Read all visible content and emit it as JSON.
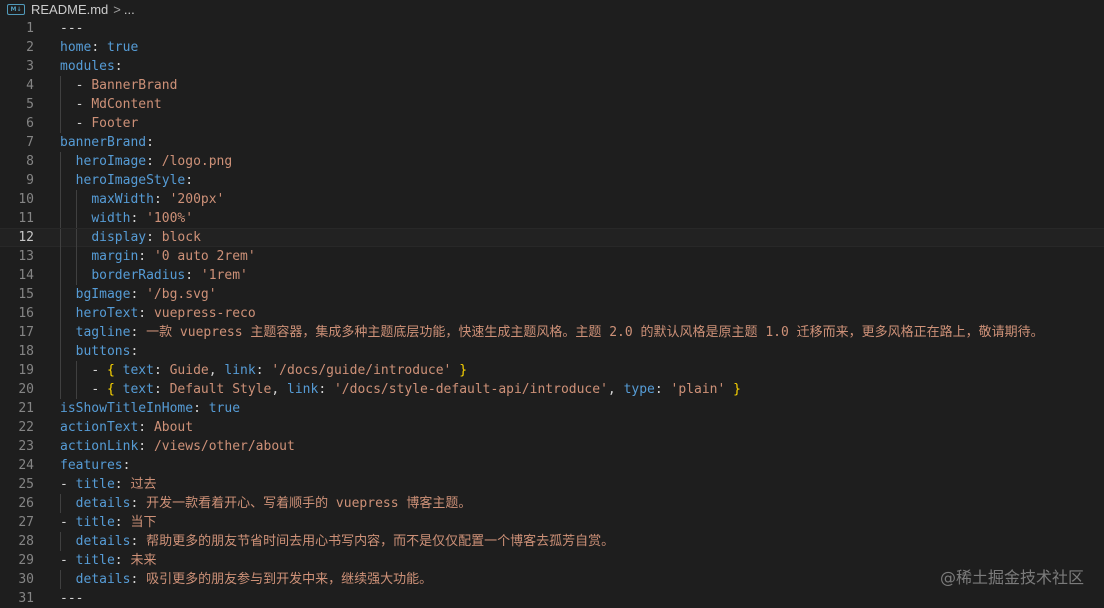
{
  "breadcrumb": {
    "file_icon": "markdown-icon",
    "file": "README.md",
    "separator": ">",
    "ellipsis": "..."
  },
  "watermark": "@稀土掘金技术社区",
  "colors": {
    "key": "#569cd6",
    "string": "#ce9178",
    "bracket": "#ffd700",
    "text": "#d4d4d4",
    "line_number": "#858585"
  },
  "current_line": 12,
  "lines": [
    {
      "n": "1",
      "indent": 0,
      "t": [
        [
          "p",
          "---"
        ]
      ]
    },
    {
      "n": "2",
      "indent": 0,
      "t": [
        [
          "k",
          "home"
        ],
        [
          "p",
          ": "
        ],
        [
          "b",
          "true"
        ]
      ]
    },
    {
      "n": "3",
      "indent": 0,
      "t": [
        [
          "k",
          "modules"
        ],
        [
          "p",
          ":"
        ]
      ]
    },
    {
      "n": "4",
      "indent": 1,
      "t": [
        [
          "p",
          "- "
        ],
        [
          "s",
          "BannerBrand"
        ]
      ]
    },
    {
      "n": "5",
      "indent": 1,
      "t": [
        [
          "p",
          "- "
        ],
        [
          "s",
          "MdContent"
        ]
      ]
    },
    {
      "n": "6",
      "indent": 1,
      "t": [
        [
          "p",
          "- "
        ],
        [
          "s",
          "Footer"
        ]
      ]
    },
    {
      "n": "7",
      "indent": 0,
      "t": [
        [
          "k",
          "bannerBrand"
        ],
        [
          "p",
          ":"
        ]
      ]
    },
    {
      "n": "8",
      "indent": 1,
      "t": [
        [
          "k",
          "heroImage"
        ],
        [
          "p",
          ": "
        ],
        [
          "s",
          "/logo.png"
        ]
      ]
    },
    {
      "n": "9",
      "indent": 1,
      "t": [
        [
          "k",
          "heroImageStyle"
        ],
        [
          "p",
          ":"
        ]
      ]
    },
    {
      "n": "10",
      "indent": 2,
      "t": [
        [
          "k",
          "maxWidth"
        ],
        [
          "p",
          ": "
        ],
        [
          "s",
          "'200px'"
        ]
      ]
    },
    {
      "n": "11",
      "indent": 2,
      "t": [
        [
          "k",
          "width"
        ],
        [
          "p",
          ": "
        ],
        [
          "s",
          "'100%'"
        ]
      ]
    },
    {
      "n": "12",
      "indent": 2,
      "t": [
        [
          "k",
          "display"
        ],
        [
          "p",
          ": "
        ],
        [
          "s",
          "block"
        ]
      ]
    },
    {
      "n": "13",
      "indent": 2,
      "t": [
        [
          "k",
          "margin"
        ],
        [
          "p",
          ": "
        ],
        [
          "s",
          "'0 auto 2rem'"
        ]
      ]
    },
    {
      "n": "14",
      "indent": 2,
      "t": [
        [
          "k",
          "borderRadius"
        ],
        [
          "p",
          ": "
        ],
        [
          "s",
          "'1rem'"
        ]
      ]
    },
    {
      "n": "15",
      "indent": 1,
      "t": [
        [
          "k",
          "bgImage"
        ],
        [
          "p",
          ": "
        ],
        [
          "s",
          "'/bg.svg'"
        ]
      ]
    },
    {
      "n": "16",
      "indent": 1,
      "t": [
        [
          "k",
          "heroText"
        ],
        [
          "p",
          ": "
        ],
        [
          "s",
          "vuepress-reco"
        ]
      ]
    },
    {
      "n": "17",
      "indent": 1,
      "t": [
        [
          "k",
          "tagline"
        ],
        [
          "p",
          ": "
        ],
        [
          "s",
          "一款 vuepress 主题容器，集成多种主题底层功能，快速生成主题风格。主题 2.0 的默认风格是原主题 1.0 迁移而来，更多风格正在路上，敬请期待。"
        ]
      ]
    },
    {
      "n": "18",
      "indent": 1,
      "t": [
        [
          "k",
          "buttons"
        ],
        [
          "p",
          ":"
        ]
      ]
    },
    {
      "n": "19",
      "indent": 2,
      "t": [
        [
          "p",
          "- "
        ],
        [
          "br",
          "{ "
        ],
        [
          "k",
          "text"
        ],
        [
          "p",
          ": "
        ],
        [
          "s",
          "Guide"
        ],
        [
          "p",
          ", "
        ],
        [
          "k",
          "link"
        ],
        [
          "p",
          ": "
        ],
        [
          "s",
          "'/docs/guide/introduce'"
        ],
        [
          "br",
          " }"
        ]
      ]
    },
    {
      "n": "20",
      "indent": 2,
      "t": [
        [
          "p",
          "- "
        ],
        [
          "br",
          "{ "
        ],
        [
          "k",
          "text"
        ],
        [
          "p",
          ": "
        ],
        [
          "s",
          "Default Style"
        ],
        [
          "p",
          ", "
        ],
        [
          "k",
          "link"
        ],
        [
          "p",
          ": "
        ],
        [
          "s",
          "'/docs/style-default-api/introduce'"
        ],
        [
          "p",
          ", "
        ],
        [
          "k",
          "type"
        ],
        [
          "p",
          ": "
        ],
        [
          "s",
          "'plain'"
        ],
        [
          "br",
          " }"
        ]
      ]
    },
    {
      "n": "21",
      "indent": 0,
      "t": [
        [
          "k",
          "isShowTitleInHome"
        ],
        [
          "p",
          ": "
        ],
        [
          "b",
          "true"
        ]
      ]
    },
    {
      "n": "22",
      "indent": 0,
      "t": [
        [
          "k",
          "actionText"
        ],
        [
          "p",
          ": "
        ],
        [
          "s",
          "About"
        ]
      ]
    },
    {
      "n": "23",
      "indent": 0,
      "t": [
        [
          "k",
          "actionLink"
        ],
        [
          "p",
          ": "
        ],
        [
          "s",
          "/views/other/about"
        ]
      ]
    },
    {
      "n": "24",
      "indent": 0,
      "t": [
        [
          "k",
          "features"
        ],
        [
          "p",
          ":"
        ]
      ]
    },
    {
      "n": "25",
      "indent": 0,
      "t": [
        [
          "p",
          "- "
        ],
        [
          "k",
          "title"
        ],
        [
          "p",
          ": "
        ],
        [
          "s",
          "过去"
        ]
      ]
    },
    {
      "n": "26",
      "indent": 1,
      "t": [
        [
          "k",
          "details"
        ],
        [
          "p",
          ": "
        ],
        [
          "s",
          "开发一款看着开心、写着顺手的 vuepress 博客主题。"
        ]
      ]
    },
    {
      "n": "27",
      "indent": 0,
      "t": [
        [
          "p",
          "- "
        ],
        [
          "k",
          "title"
        ],
        [
          "p",
          ": "
        ],
        [
          "s",
          "当下"
        ]
      ]
    },
    {
      "n": "28",
      "indent": 1,
      "t": [
        [
          "k",
          "details"
        ],
        [
          "p",
          ": "
        ],
        [
          "s",
          "帮助更多的朋友节省时间去用心书写内容，而不是仅仅配置一个博客去孤芳自赏。"
        ]
      ]
    },
    {
      "n": "29",
      "indent": 0,
      "t": [
        [
          "p",
          "- "
        ],
        [
          "k",
          "title"
        ],
        [
          "p",
          ": "
        ],
        [
          "s",
          "未来"
        ]
      ]
    },
    {
      "n": "30",
      "indent": 1,
      "t": [
        [
          "k",
          "details"
        ],
        [
          "p",
          ": "
        ],
        [
          "s",
          "吸引更多的朋友参与到开发中来，继续强大功能。"
        ]
      ]
    },
    {
      "n": "31",
      "indent": 0,
      "t": [
        [
          "p",
          "---"
        ]
      ]
    }
  ]
}
